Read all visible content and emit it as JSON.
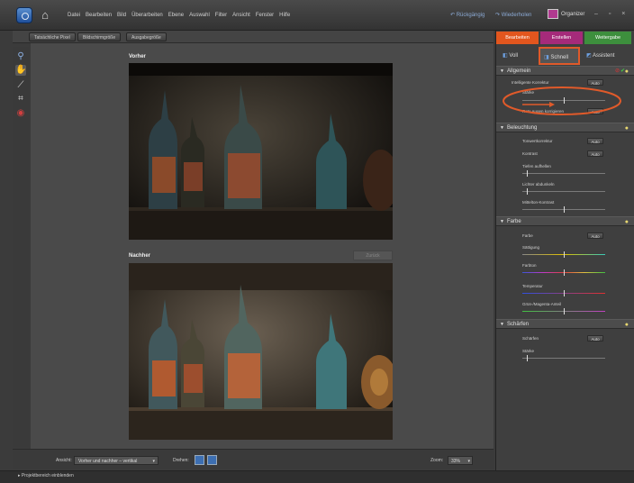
{
  "menubar": {
    "items": [
      "Datei",
      "Bearbeiten",
      "Bild",
      "Überarbeiten",
      "Ebene",
      "Auswahl",
      "Filter",
      "Ansicht",
      "Fenster",
      "Hilfe"
    ],
    "undo": "Rückgängig",
    "redo": "Wiederholen",
    "organizer": "Organizer",
    "window_controls": "– ▫ ×"
  },
  "optbar": {
    "buttons": [
      "Tatsächliche Pixel",
      "Bildschirmgröße",
      "Ausgabegröße"
    ]
  },
  "tools": [
    "zoom-icon",
    "hand-icon",
    "brush-icon",
    "crop-icon",
    "redeye-icon"
  ],
  "canvas": {
    "before_label": "Vorher",
    "after_label": "Nachher",
    "reset_button": "Zurück"
  },
  "viewbar": {
    "view_label": "Ansicht:",
    "view_value": "Vorher und nachher – vertikal",
    "rotate_label": "Drehen:",
    "zoom_label": "Zoom:",
    "zoom_value": "33%"
  },
  "statusbar": {
    "text": "Projektbereich einblenden"
  },
  "rpanel": {
    "tabs": [
      {
        "label": "Bearbeiten",
        "color": "#e2561e"
      },
      {
        "label": "Erstellen",
        "color": "#a52a7a"
      },
      {
        "label": "Weitergabe",
        "color": "#3d8f3d"
      }
    ],
    "modes": {
      "full": "Voll",
      "quick": "Schnell",
      "guided": "Assistent"
    },
    "sections": {
      "allgemein": {
        "title": "Allgemein",
        "auto_fix_label": "Intelligente Korrektur",
        "auto_label": "Auto",
        "amount_label": "Stärke",
        "amount_value": 0.5,
        "redeye_label": "Rote Augen korrigieren",
        "redeye_auto": "Auto"
      },
      "beleuchtung": {
        "title": "Beleuchtung",
        "tonal_label": "Tonwertkorrektur",
        "tonal_auto": "Auto",
        "contrast_label": "Kontrast",
        "contrast_auto": "Auto",
        "shadows_label": "Tiefen aufhellen",
        "shadows_value": 0.05,
        "highlights_label": "Lichter abdunkeln",
        "highlights_value": 0.05,
        "midtone_label": "Mittelton-Kontrast",
        "midtone_value": 0.5
      },
      "farbe": {
        "title": "Farbe",
        "color_label": "Farbe",
        "color_auto": "Auto",
        "saturation_label": "Sättigung",
        "saturation_value": 0.5,
        "hue_label": "Farbton",
        "hue_value": 0.5,
        "temperature_label": "Temperatur",
        "temperature_value": 0.5,
        "tint_label": "Grün-/Magenta-Anteil",
        "tint_value": 0.5
      },
      "scharfen": {
        "title": "Schärfen",
        "sharpen_label": "Schärfen",
        "sharpen_auto": "Auto",
        "amount_label": "Stärke",
        "amount_value": 0.05
      }
    }
  },
  "annotation_color": "#e05a2a"
}
